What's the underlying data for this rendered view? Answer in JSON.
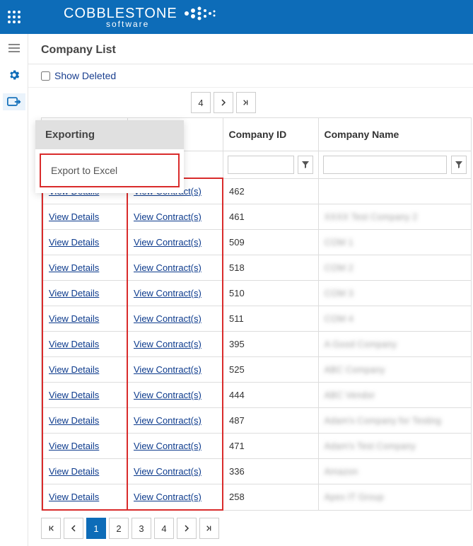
{
  "header": {
    "brand_main": "COBBLESTONE",
    "brand_sub": "software"
  },
  "page_title": "Company List",
  "toolbar": {
    "show_deleted_label": "Show Deleted"
  },
  "export_popup": {
    "title": "Exporting",
    "item": "Export to Excel"
  },
  "pager_top": {
    "page4": "4"
  },
  "pager_bottom": {
    "page1": "1",
    "page2": "2",
    "page3": "3",
    "page4": "4"
  },
  "columns": {
    "details": "",
    "contracts": "",
    "company_id": "Company ID",
    "company_name": "Company Name"
  },
  "labels": {
    "view_details": "View Details",
    "view_contracts": "View Contract(s)"
  },
  "rows": [
    {
      "id": "462",
      "name": ""
    },
    {
      "id": "461",
      "name": "XXXX Test Company 2"
    },
    {
      "id": "509",
      "name": "COM 1"
    },
    {
      "id": "518",
      "name": "COM 2"
    },
    {
      "id": "510",
      "name": "COM 3"
    },
    {
      "id": "511",
      "name": "COM 4"
    },
    {
      "id": "395",
      "name": "A Good Company"
    },
    {
      "id": "525",
      "name": "ABC Company"
    },
    {
      "id": "444",
      "name": "ABC Vendor"
    },
    {
      "id": "487",
      "name": "Adam's Company for Testing"
    },
    {
      "id": "471",
      "name": "Adam's Test Company"
    },
    {
      "id": "336",
      "name": "Amazon"
    },
    {
      "id": "258",
      "name": "Apex IT Group"
    }
  ]
}
